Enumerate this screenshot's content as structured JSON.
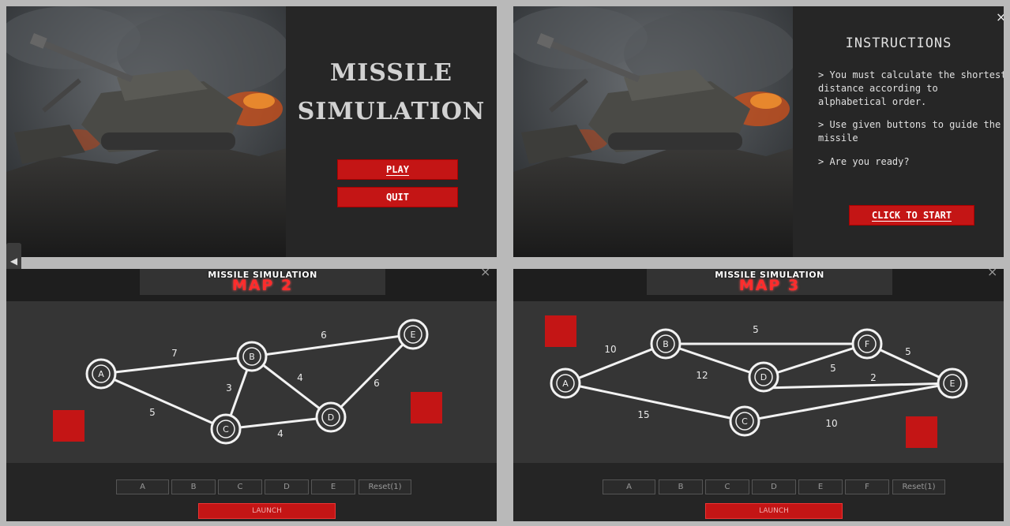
{
  "start_screen": {
    "title_line1": "MISSILE",
    "title_line2": "SIMULATION",
    "play_label": "PLAY",
    "quit_label": "QUIT"
  },
  "instructions_screen": {
    "heading": "INSTRUCTIONS",
    "line1": "> You must calculate the shortest distance according to alphabetical order.",
    "line2": "> Use given buttons to guide the  missile",
    "line3": "> Are you ready?",
    "start_label": "CLICK TO START",
    "close_glyph": "×"
  },
  "map2": {
    "header_top": "MISSILE SIMULATION",
    "header_map": "MAP 2",
    "close_glyph": "×",
    "nodes": [
      "A",
      "B",
      "C",
      "D",
      "E"
    ],
    "edge_weights": {
      "AB": "7",
      "AC": "5",
      "BC": "3",
      "BD": "4",
      "BE": "6",
      "CD": "4",
      "DE": "6"
    },
    "buttons": [
      "A",
      "B",
      "C",
      "D",
      "E"
    ],
    "reset_label": "Reset(1)",
    "launch_label": "LAUNCH"
  },
  "map3": {
    "header_top": "MISSILE SIMULATION",
    "header_map": "MAP 3",
    "close_glyph": "×",
    "nodes": [
      "A",
      "B",
      "C",
      "D",
      "E",
      "F"
    ],
    "edge_weights": {
      "AB": "10",
      "AC": "15",
      "BF": "5",
      "BD": "12",
      "DF": "5",
      "DE": "2",
      "FE": "5",
      "CE": "10"
    },
    "buttons": [
      "A",
      "B",
      "C",
      "D",
      "E",
      "F"
    ],
    "reset_label": "Reset(1)",
    "launch_label": "LAUNCH"
  },
  "colors": {
    "accent_red": "#c41515",
    "panel_bg": "#252525",
    "field_bg": "#353535"
  },
  "icons": {
    "side_arrow": "◀"
  }
}
